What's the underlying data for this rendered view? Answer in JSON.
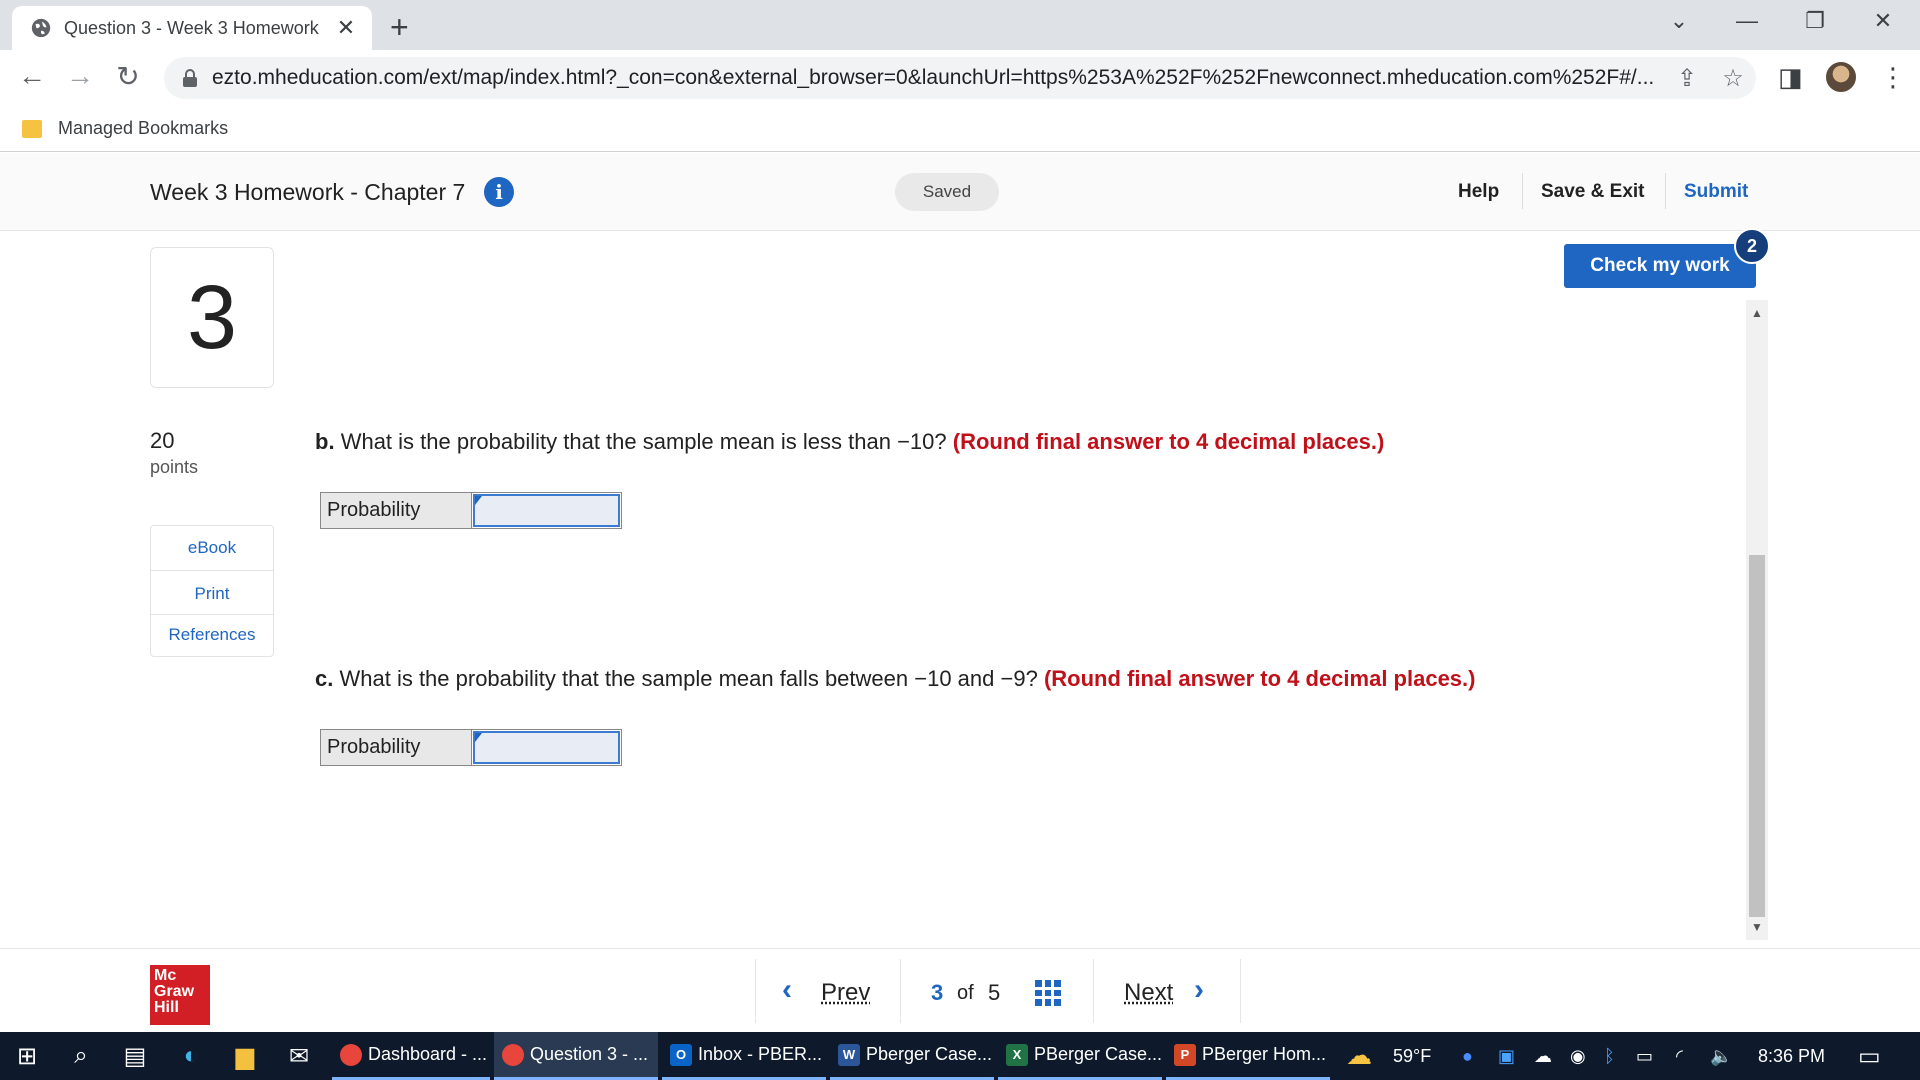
{
  "browser": {
    "tab_title": "Question 3 - Week 3 Homework",
    "tab_close": "✕",
    "new_tab": "+",
    "url": "ezto.mheducation.com/ext/map/index.html?_con=con&external_browser=0&launchUrl=https%253A%252F%252Fnewconnect.mheducation.com%252F#/...",
    "bookmarks_label": "Managed Bookmarks",
    "icons": {
      "back": "arrow-left-icon",
      "forward": "arrow-right-icon",
      "reload": "reload-icon",
      "share": "share-icon",
      "bookmark": "star-icon",
      "sidepanel": "sidepanel-icon",
      "menu": "more-vert-icon"
    }
  },
  "header": {
    "assignment_title": "Week 3 Homework - Chapter 7",
    "status": "Saved",
    "help": "Help",
    "save_exit": "Save & Exit",
    "submit": "Submit"
  },
  "question": {
    "number": "3",
    "points_value": "20",
    "points_label": "points",
    "side_links": [
      "eBook",
      "Print",
      "References"
    ],
    "check_work": "Check my work",
    "check_badge": "2",
    "parts": [
      {
        "letter": "b.",
        "text": "What is the probability that the sample mean is less than −10?",
        "instruction": "(Round final answer to 4 decimal places.)",
        "answer_label": "Probability",
        "answer_value": ""
      },
      {
        "letter": "c.",
        "text": "What is the probability that the sample mean falls between −10 and −9?",
        "instruction": "(Round final answer to 4 decimal places.)",
        "answer_label": "Probability",
        "answer_value": ""
      }
    ]
  },
  "footer": {
    "logo_lines": [
      "Mc",
      "Graw",
      "Hill"
    ],
    "prev": "Prev",
    "current_page": "3",
    "of": "of",
    "total_pages": "5",
    "next": "Next"
  },
  "taskbar": {
    "items": [
      {
        "label": "Dashboard - ...",
        "icon": "chrome-icon"
      },
      {
        "label": "Question 3 - ...",
        "icon": "chrome-icon"
      },
      {
        "label": "Inbox - PBER...",
        "icon": "outlook-icon"
      },
      {
        "label": "Pberger Case...",
        "icon": "word-icon"
      },
      {
        "label": "PBerger Case...",
        "icon": "excel-icon"
      },
      {
        "label": "PBerger Hom...",
        "icon": "powerpoint-icon"
      }
    ],
    "weather": "59°F",
    "time": "8:36 PM"
  },
  "colors": {
    "accent": "#1f66c2",
    "instruction_red": "#c0111b",
    "brand_red": "#d21f25",
    "taskbar": "#0e1a2b"
  }
}
